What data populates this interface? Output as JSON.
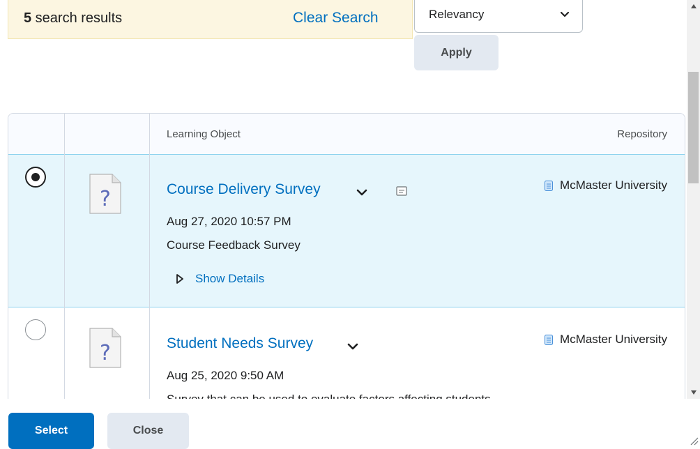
{
  "search": {
    "count": "5",
    "count_suffix": " search results",
    "clear_label": "Clear Search"
  },
  "sort": {
    "selected": "Relevancy",
    "apply_label": "Apply"
  },
  "table": {
    "headers": {
      "learning_object": "Learning Object",
      "repository": "Repository"
    },
    "rows": [
      {
        "title": "Course Delivery Survey",
        "date": "Aug 27, 2020 10:57 PM",
        "description": "Course Feedback Survey",
        "show_details": "Show Details",
        "repository": "McMaster University",
        "selected": true
      },
      {
        "title": "Student Needs Survey",
        "date": "Aug 25, 2020 9:50 AM",
        "description": "Survey that can be used to evaluate factors affecting students",
        "repository": "McMaster University",
        "selected": false
      }
    ]
  },
  "footer": {
    "select_label": "Select",
    "close_label": "Close"
  },
  "colors": {
    "link": "#006fbf",
    "selected_row": "#e6f6fc",
    "banner": "#fcf6e1",
    "primary_button": "#006fbf"
  },
  "icons": [
    "chevron-down-icon",
    "unknown-document-icon",
    "preview-icon",
    "repository-icon",
    "triangle-right-icon",
    "resize-grip-icon"
  ]
}
